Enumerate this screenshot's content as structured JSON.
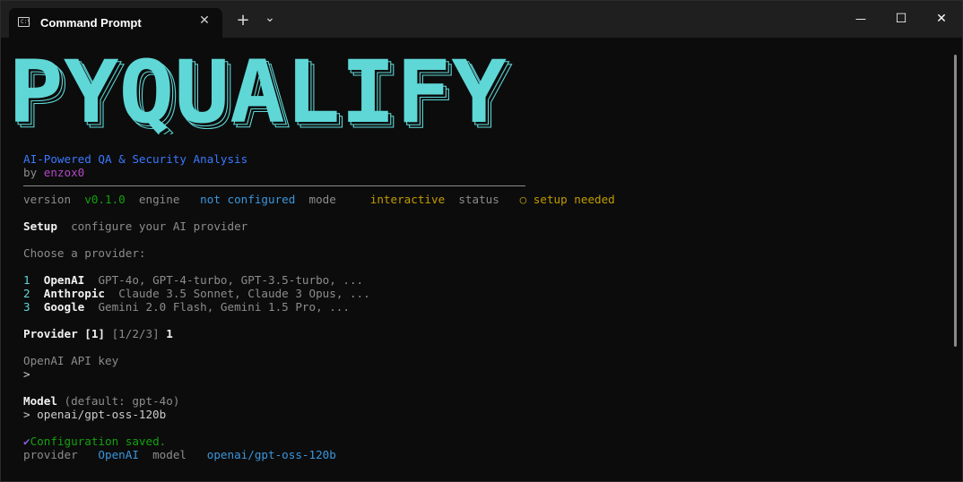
{
  "window": {
    "tab_title": "Command Prompt",
    "tab_icon_glyph": "C:\\",
    "new_tab_label": "+",
    "dropdown_label": "⌄",
    "minimize_label": "—",
    "maximize_label": "☐",
    "close_label": "✕",
    "tab_close_label": "✕"
  },
  "banner": {
    "text": "PYQUALIFY",
    "color": "#5fd7d7"
  },
  "header": {
    "subtitle": "AI-Powered QA & Security Analysis",
    "by_label": "by",
    "author": "enzox0"
  },
  "status_bar": {
    "version_label": "version",
    "version_value": "v0.1.0",
    "engine_label": "engine",
    "engine_value": "not configured",
    "mode_label": "mode",
    "mode_value": "interactive",
    "status_label": "status",
    "status_icon": "○",
    "status_value": "setup needed"
  },
  "setup": {
    "title": "Setup",
    "description": "configure your AI provider",
    "choose_prompt": "Choose a provider:"
  },
  "providers": [
    {
      "num": "1",
      "name": "OpenAI",
      "models": "GPT-4o, GPT-4-turbo, GPT-3.5-turbo, ..."
    },
    {
      "num": "2",
      "name": "Anthropic",
      "models": "Claude 3.5 Sonnet, Claude 3 Opus, ..."
    },
    {
      "num": "3",
      "name": "Google",
      "models": "Gemini 2.0 Flash, Gemini 1.5 Pro, ..."
    }
  ],
  "provider_prompt": {
    "label": "Provider [1]",
    "options": "[1/2/3]",
    "answer": "1"
  },
  "api_key_prompt": {
    "label": "OpenAI API key",
    "cursor": ">"
  },
  "model_prompt": {
    "label": "Model",
    "default_hint": "(default: gpt-4o)",
    "input": "> openai/gpt-oss-120b"
  },
  "result": {
    "check_icon": "✔",
    "message": "Configuration saved.",
    "provider_label": "provider",
    "provider_value": "OpenAI",
    "model_label": "model",
    "model_value": "openai/gpt-oss-120b"
  }
}
